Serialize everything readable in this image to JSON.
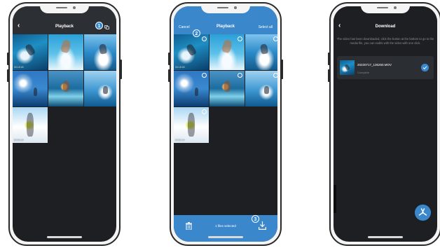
{
  "screen1": {
    "title": "Playback",
    "back_icon": "chevron-left-icon",
    "select_icon": "multi-select-icon",
    "callout": "1",
    "thumbnails": [
      {
        "name": "video-surfing-1",
        "duration": "00:15:03"
      },
      {
        "name": "photo-surfing-2",
        "duration": ""
      },
      {
        "name": "photo-surfing-3",
        "duration": ""
      },
      {
        "name": "photo-sky-4",
        "duration": ""
      },
      {
        "name": "photo-surfing-5",
        "duration": ""
      },
      {
        "name": "photo-surfing-6",
        "duration": ""
      },
      {
        "name": "video-skiing-7",
        "duration": "00:00:24"
      }
    ]
  },
  "screen2": {
    "title": "Playback",
    "cancel_label": "Cancel",
    "select_all_label": "Select all",
    "callout_select": "2",
    "callout_download": "3",
    "selected_info": "1 files selected",
    "thumbnails": [
      {
        "name": "video-surfing-1",
        "duration": "00:15:03",
        "checked": true
      },
      {
        "name": "photo-surfing-2",
        "duration": "",
        "checked": false
      },
      {
        "name": "photo-surfing-3",
        "duration": "",
        "checked": false
      },
      {
        "name": "photo-sky-4",
        "duration": "",
        "checked": false
      },
      {
        "name": "photo-surfing-5",
        "duration": "",
        "checked": false
      },
      {
        "name": "photo-surfing-6",
        "duration": "",
        "checked": false
      },
      {
        "name": "video-skiing-7",
        "duration": "00:00:24",
        "checked": false
      }
    ]
  },
  "screen3": {
    "title": "Download",
    "description": "The video has been downloaded, click the button at the bottom to go to the media file, you can exdits with the video with one click.",
    "file_name": "20220717_135250.MOV",
    "status": "Complete",
    "fab_icon": "clip-editor-icon"
  },
  "colors": {
    "accent": "#3b87cc",
    "screen_bg": "#1d1f22",
    "topbar_bg": "#2c2f33"
  }
}
